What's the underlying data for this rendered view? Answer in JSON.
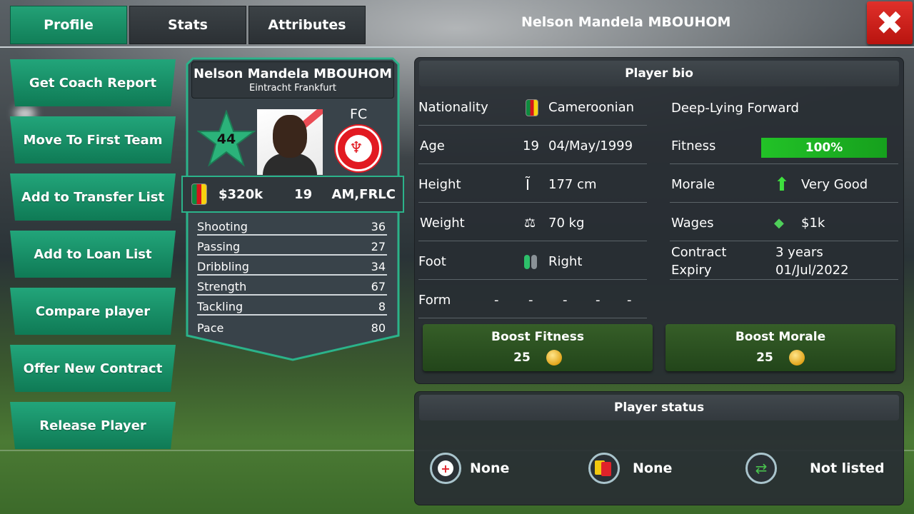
{
  "tabs": [
    {
      "label": "Profile"
    },
    {
      "label": "Stats"
    },
    {
      "label": "Attributes"
    }
  ],
  "header": {
    "player_name": "Nelson Mandela MBOUHOM",
    "close_label": "✖"
  },
  "actions": [
    {
      "label": "Get Coach Report"
    },
    {
      "label": "Move To First Team"
    },
    {
      "label": "Add to Transfer List"
    },
    {
      "label": "Add to Loan List"
    },
    {
      "label": "Compare player"
    },
    {
      "label": "Offer New Contract"
    },
    {
      "label": "Release Player"
    }
  ],
  "card": {
    "name": "Nelson Mandela MBOUHOM",
    "club": "Eintracht Frankfurt",
    "rating": "44",
    "position": "FC",
    "value": "$320k",
    "age": "19",
    "roles": "AM,FRLC",
    "stats": [
      {
        "name": "Shooting",
        "value": "36"
      },
      {
        "name": "Passing",
        "value": "27"
      },
      {
        "name": "Dribbling",
        "value": "34"
      },
      {
        "name": "Strength",
        "value": "67"
      },
      {
        "name": "Tackling",
        "value": "8"
      },
      {
        "name": "Pace",
        "value": "80"
      }
    ]
  },
  "bio": {
    "title": "Player bio",
    "nationality_label": "Nationality",
    "nationality": "Cameroonian",
    "age_label": "Age",
    "age": "19",
    "dob": "04/May/1999",
    "height_label": "Height",
    "height": "177 cm",
    "weight_label": "Weight",
    "weight": "70 kg",
    "foot_label": "Foot",
    "foot": "Right",
    "form_label": "Form",
    "form": [
      "-",
      "-",
      "-",
      "-",
      "-"
    ],
    "role": "Deep-Lying Forward",
    "fitness_label": "Fitness",
    "fitness": "100%",
    "fitness_fraction": 1.0,
    "morale_label": "Morale",
    "morale": "Very Good",
    "wages_label": "Wages",
    "wages": "$1k",
    "contract_label_1": "Contract",
    "contract_label_2": "Expiry",
    "contract_length": "3 years",
    "contract_expiry": "01/Jul/2022",
    "boost_fitness_label": "Boost Fitness",
    "boost_fitness_cost": "25",
    "boost_morale_label": "Boost Morale",
    "boost_morale_cost": "25"
  },
  "status": {
    "title": "Player status",
    "injury": "None",
    "cards": "None",
    "transfer": "Not listed"
  },
  "colors": {
    "accent": "#1a9268",
    "fitness": "#22c227",
    "close": "#d52420"
  }
}
